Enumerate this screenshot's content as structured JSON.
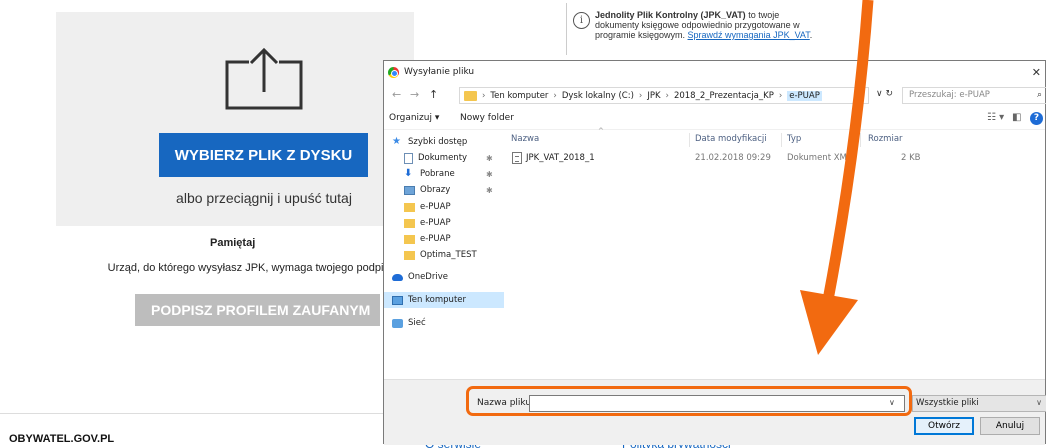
{
  "page": {
    "choose_button": "WYBIERZ PLIK Z DYSKU",
    "drop_text": "albo przeciągnij i upuść tutaj",
    "remember_title": "Pamiętaj",
    "remember_text": "Urząd, do którego wysyłasz JPK, wymaga twojego podpisu",
    "profile_button": "PODPISZ PROFILEM ZAUFANYM",
    "footer_brand": "OBYWATEL.GOV.PL",
    "footer_link_1": "O serwisie",
    "footer_link_2": "Polityka prywatności",
    "info": {
      "bold": "Jednolity Plik Kontrolny (JPK_VAT)",
      "text": " to twoje dokumenty księgowe odpowiednio przygotowane w programie księgowym. ",
      "link": "Sprawdź wymagania JPK_VAT",
      "after": "."
    }
  },
  "dialog": {
    "title": "Wysyłanie pliku",
    "path": [
      "Ten komputer",
      "Dysk lokalny (C:)",
      "JPK",
      "2018_2_Prezentacja_KP",
      "e-PUAP"
    ],
    "search_placeholder": "Przeszukaj: e-PUAP",
    "toolbar": {
      "organize": "Organizuj ▾",
      "new_folder": "Nowy folder"
    },
    "nav": {
      "quick_access": "Szybki dostęp",
      "documents": "Dokumenty",
      "downloads": "Pobrane",
      "pictures": "Obrazy",
      "folder1": "e-PUAP",
      "folder2": "e-PUAP",
      "folder3": "e-PUAP",
      "folder4": "Optima_TEST",
      "onedrive": "OneDrive",
      "this_pc": "Ten komputer",
      "network": "Sieć"
    },
    "columns": {
      "name": "Nazwa",
      "modified": "Data modyfikacji",
      "type": "Typ",
      "size": "Rozmiar"
    },
    "files": [
      {
        "name": "JPK_VAT_2018_1",
        "modified": "21.02.2018 09:29",
        "type": "Dokument XML",
        "size": "2 KB"
      }
    ],
    "filename_label": "Nazwa pliku:",
    "filename_value": "",
    "filter": "Wszystkie pliki",
    "open_button": "Otwórz",
    "cancel_button": "Anuluj"
  },
  "colors": {
    "accent_blue": "#1767c0",
    "annotation_orange": "#f26a10"
  }
}
